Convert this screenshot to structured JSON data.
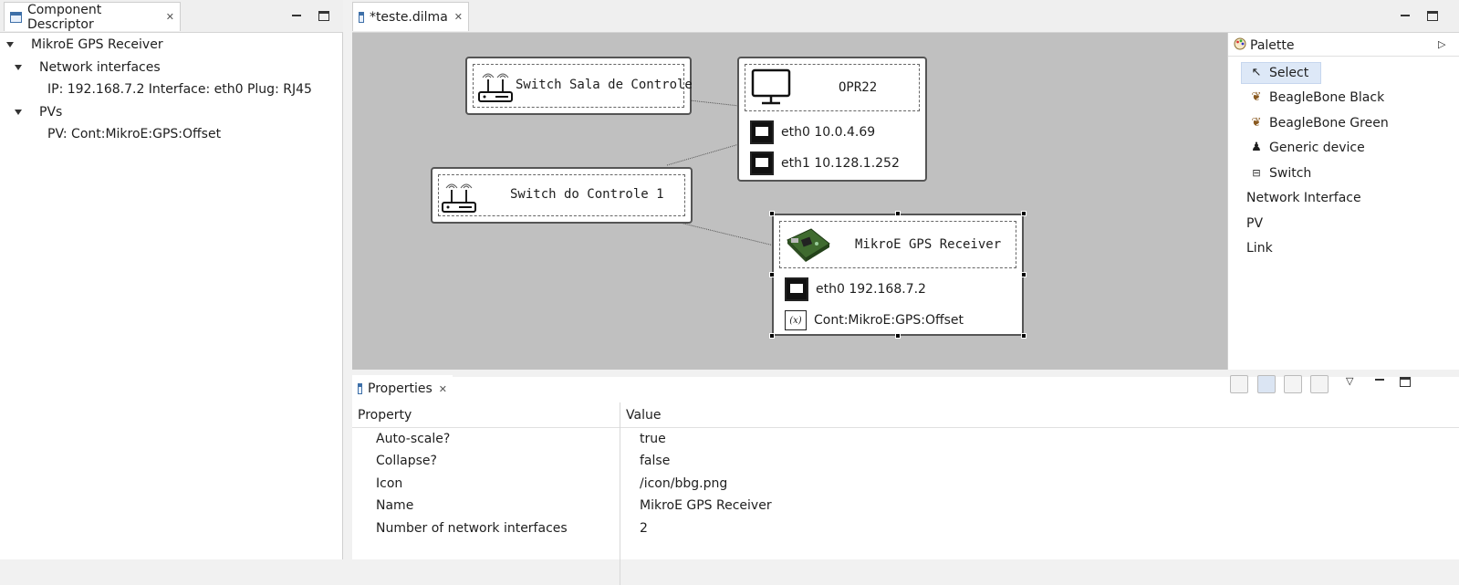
{
  "left_panel": {
    "tab_title": "Component Descriptor",
    "tree": {
      "root": "MikroE GPS Receiver",
      "network_interfaces_label": "Network interfaces",
      "interface_entry": "IP: 192.168.7.2 Interface: eth0 Plug: RJ45",
      "pvs_label": "PVs",
      "pv_entry": "PV: Cont:MikroE:GPS:Offset"
    }
  },
  "editor": {
    "tab_title": "*teste.dilma",
    "nodes": {
      "switch_sala": {
        "name": "Switch Sala de Controle"
      },
      "switch_controle": {
        "name": "Switch do Controle 1"
      },
      "opr22": {
        "name": "OPR22",
        "interfaces": [
          {
            "label": "eth0",
            "ip": "10.0.4.69"
          },
          {
            "label": "eth1",
            "ip": "10.128.1.252"
          }
        ]
      },
      "gps": {
        "name": "MikroE GPS Receiver",
        "interface": {
          "label": "eth0",
          "ip": "192.168.7.2"
        },
        "pv": "Cont:MikroE:GPS:Offset",
        "pv_icon_text": "(x)"
      }
    }
  },
  "palette": {
    "title": "Palette",
    "items": [
      {
        "label": "Select",
        "icon": "cursor-icon"
      },
      {
        "label": "BeagleBone Black",
        "icon": "beaglebone-icon"
      },
      {
        "label": "BeagleBone Green",
        "icon": "beaglebone-icon"
      },
      {
        "label": "Generic device",
        "icon": "penguin-icon"
      },
      {
        "label": "Switch",
        "icon": "router-icon"
      },
      {
        "label": "Network Interface",
        "icon": ""
      },
      {
        "label": "PV",
        "icon": ""
      },
      {
        "label": "Link",
        "icon": ""
      }
    ]
  },
  "properties": {
    "tab_title": "Properties",
    "col_property": "Property",
    "col_value": "Value",
    "rows": [
      {
        "property": "Auto-scale?",
        "value": "true"
      },
      {
        "property": "Collapse?",
        "value": "false"
      },
      {
        "property": "Icon",
        "value": "/icon/bbg.png"
      },
      {
        "property": "Name",
        "value": "MikroE GPS Receiver"
      },
      {
        "property": "Number of network interfaces",
        "value": "2"
      }
    ]
  },
  "colors": {
    "canvas_bg": "#c0c0c0",
    "selection_bg": "#dde8f7"
  }
}
